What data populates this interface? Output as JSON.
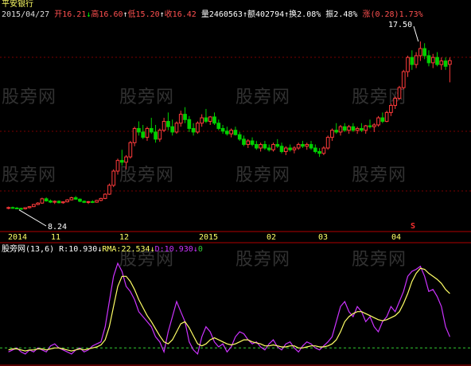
{
  "stock_name": "平安银行",
  "info_bar": {
    "date": "2015/04/27",
    "open_label": "开",
    "open": "16.21",
    "high_label": "高",
    "high": "16.60",
    "low_label": "低",
    "low": "15.20",
    "close_label": "收",
    "close": "16.42",
    "volume_label": "量",
    "volume": "2460563",
    "amount_label": "额",
    "amount": "402794",
    "turnover_label": "换",
    "turnover": "2.08%",
    "amplitude_label": "振",
    "amplitude": "2.48%",
    "change_label": "涨",
    "change": "(0.28)",
    "change_pct": "1.73%"
  },
  "price_annotations": {
    "max_label": "17.50",
    "min_label": "8.24"
  },
  "time_axis": [
    "2014",
    "11",
    "12",
    "2015",
    "02",
    "03",
    "04"
  ],
  "event_marker": "S",
  "indicator": {
    "name": "股旁网",
    "params": "(13,6)",
    "r_label": "R:10.930",
    "rma_label": "RMA:22.534",
    "d_label": "D:10.930",
    "tail_value": "0"
  },
  "watermark": "股旁网",
  "colors": {
    "background": "#000000",
    "up": "#ff3b3b",
    "down": "#00d000",
    "axis": "#b00000",
    "r_line": "#cc33ff",
    "rma_line": "#ffff66",
    "zero_line": "#33cc33"
  },
  "chart_data": {
    "type": "candlestick",
    "y_range": [
      7.2,
      18.4
    ],
    "candles": [
      [
        8.1,
        8.2,
        8.05,
        8.15
      ],
      [
        8.15,
        8.2,
        8.08,
        8.12
      ],
      [
        8.12,
        8.18,
        8.05,
        8.1
      ],
      [
        8.1,
        8.14,
        8.02,
        8.08
      ],
      [
        8.08,
        8.16,
        8.04,
        8.14
      ],
      [
        8.14,
        8.22,
        8.1,
        8.2
      ],
      [
        8.2,
        8.35,
        8.18,
        8.32
      ],
      [
        8.32,
        8.45,
        8.28,
        8.4
      ],
      [
        8.4,
        8.7,
        8.36,
        8.64
      ],
      [
        8.64,
        8.72,
        8.48,
        8.52
      ],
      [
        8.52,
        8.6,
        8.4,
        8.45
      ],
      [
        8.45,
        8.55,
        8.35,
        8.5
      ],
      [
        8.5,
        8.55,
        8.38,
        8.42
      ],
      [
        8.42,
        8.5,
        8.36,
        8.47
      ],
      [
        8.47,
        8.62,
        8.44,
        8.58
      ],
      [
        8.58,
        8.76,
        8.55,
        8.7
      ],
      [
        8.7,
        8.8,
        8.58,
        8.62
      ],
      [
        8.62,
        8.66,
        8.45,
        8.5
      ],
      [
        8.5,
        8.55,
        8.4,
        8.44
      ],
      [
        8.44,
        8.52,
        8.35,
        8.48
      ],
      [
        8.48,
        8.56,
        8.4,
        8.45
      ],
      [
        8.45,
        8.58,
        8.42,
        8.55
      ],
      [
        8.55,
        8.7,
        8.5,
        8.66
      ],
      [
        8.66,
        8.95,
        8.62,
        8.9
      ],
      [
        8.9,
        9.5,
        8.86,
        9.4
      ],
      [
        9.4,
        10.3,
        9.3,
        10.2
      ],
      [
        10.2,
        10.9,
        10.0,
        10.8
      ],
      [
        10.8,
        11.4,
        10.5,
        10.7
      ],
      [
        10.7,
        11.1,
        10.3,
        11.0
      ],
      [
        11.0,
        11.9,
        10.9,
        11.8
      ],
      [
        11.8,
        12.7,
        11.6,
        12.6
      ],
      [
        12.6,
        13.0,
        12.2,
        12.4
      ],
      [
        12.4,
        12.8,
        12.0,
        12.1
      ],
      [
        12.1,
        12.7,
        11.9,
        12.6
      ],
      [
        12.6,
        13.2,
        12.3,
        12.4
      ],
      [
        12.4,
        12.8,
        11.8,
        12.0
      ],
      [
        12.0,
        12.6,
        11.85,
        12.5
      ],
      [
        12.5,
        13.2,
        12.4,
        13.0
      ],
      [
        13.0,
        13.5,
        12.5,
        12.7
      ],
      [
        12.7,
        13.1,
        12.2,
        12.4
      ],
      [
        12.4,
        13.0,
        12.3,
        12.9
      ],
      [
        12.9,
        13.6,
        12.7,
        13.4
      ],
      [
        13.4,
        13.8,
        12.9,
        13.1
      ],
      [
        13.1,
        13.3,
        12.4,
        12.6
      ],
      [
        12.6,
        12.9,
        12.2,
        12.4
      ],
      [
        12.4,
        13.0,
        12.3,
        12.9
      ],
      [
        12.9,
        13.4,
        12.7,
        13.2
      ],
      [
        13.2,
        13.7,
        12.9,
        13.0
      ],
      [
        13.0,
        13.3,
        12.8,
        13.25
      ],
      [
        13.25,
        13.5,
        12.8,
        12.9
      ],
      [
        12.9,
        13.1,
        12.5,
        12.6
      ],
      [
        12.6,
        12.8,
        12.3,
        12.45
      ],
      [
        12.45,
        12.7,
        12.2,
        12.3
      ],
      [
        12.3,
        12.6,
        12.1,
        12.5
      ],
      [
        12.5,
        12.7,
        12.2,
        12.25
      ],
      [
        12.25,
        12.4,
        11.9,
        12.0
      ],
      [
        12.0,
        12.2,
        11.6,
        11.7
      ],
      [
        11.7,
        12.0,
        11.5,
        11.9
      ],
      [
        11.9,
        12.1,
        11.6,
        11.7
      ],
      [
        11.7,
        11.9,
        11.4,
        11.5
      ],
      [
        11.5,
        11.8,
        11.3,
        11.7
      ],
      [
        11.7,
        11.9,
        11.4,
        11.5
      ],
      [
        11.5,
        11.7,
        11.3,
        11.4
      ],
      [
        11.4,
        11.8,
        11.3,
        11.7
      ],
      [
        11.7,
        12.0,
        11.5,
        11.6
      ],
      [
        11.6,
        11.8,
        11.2,
        11.3
      ],
      [
        11.3,
        11.6,
        11.1,
        11.5
      ],
      [
        11.5,
        11.7,
        11.3,
        11.4
      ],
      [
        11.4,
        11.6,
        11.2,
        11.5
      ],
      [
        11.5,
        11.8,
        11.4,
        11.7
      ],
      [
        11.7,
        11.9,
        11.5,
        11.6
      ],
      [
        11.6,
        11.8,
        11.4,
        11.7
      ],
      [
        11.7,
        11.9,
        11.4,
        11.5
      ],
      [
        11.5,
        11.7,
        11.2,
        11.3
      ],
      [
        11.3,
        11.5,
        11.0,
        11.2
      ],
      [
        11.2,
        11.6,
        11.1,
        11.5
      ],
      [
        11.5,
        12.2,
        11.4,
        12.1
      ],
      [
        12.1,
        12.6,
        11.9,
        12.5
      ],
      [
        12.5,
        12.9,
        12.3,
        12.4
      ],
      [
        12.4,
        12.8,
        12.2,
        12.7
      ],
      [
        12.7,
        12.9,
        12.4,
        12.5
      ],
      [
        12.5,
        12.8,
        12.3,
        12.7
      ],
      [
        12.7,
        12.9,
        12.4,
        12.5
      ],
      [
        12.5,
        12.7,
        12.3,
        12.6
      ],
      [
        12.6,
        12.9,
        12.4,
        12.5
      ],
      [
        12.5,
        12.8,
        12.3,
        12.75
      ],
      [
        12.75,
        13.1,
        12.6,
        12.7
      ],
      [
        12.7,
        12.9,
        12.4,
        12.8
      ],
      [
        12.8,
        13.3,
        12.7,
        13.2
      ],
      [
        13.2,
        13.5,
        12.9,
        13.0
      ],
      [
        13.0,
        13.6,
        12.95,
        13.5
      ],
      [
        13.5,
        14.0,
        13.3,
        13.9
      ],
      [
        13.9,
        14.4,
        13.7,
        14.3
      ],
      [
        14.3,
        15.0,
        14.2,
        14.9
      ],
      [
        14.9,
        15.9,
        14.8,
        15.8
      ],
      [
        15.8,
        16.7,
        15.5,
        16.6
      ],
      [
        16.6,
        17.0,
        15.9,
        16.2
      ],
      [
        16.2,
        16.9,
        16.0,
        16.7
      ],
      [
        16.7,
        17.5,
        16.4,
        17.1
      ],
      [
        17.1,
        17.4,
        16.5,
        16.7
      ],
      [
        16.7,
        17.0,
        16.1,
        16.3
      ],
      [
        16.3,
        16.8,
        16.0,
        16.6
      ],
      [
        16.6,
        16.9,
        16.1,
        16.2
      ],
      [
        16.2,
        16.6,
        15.9,
        16.4
      ],
      [
        16.4,
        16.6,
        15.9,
        16.1
      ],
      [
        16.21,
        16.6,
        15.2,
        16.42
      ]
    ],
    "indicator_series": [
      {
        "name": "R",
        "values": [
          10,
          12,
          14,
          10,
          8,
          12,
          10,
          14,
          12,
          10,
          16,
          18,
          14,
          12,
          10,
          8,
          12,
          14,
          10,
          12,
          16,
          18,
          20,
          35,
          60,
          85,
          98,
          90,
          75,
          70,
          62,
          50,
          45,
          40,
          35,
          25,
          20,
          10,
          30,
          45,
          60,
          50,
          40,
          20,
          12,
          8,
          25,
          35,
          30,
          20,
          15,
          18,
          10,
          15,
          25,
          30,
          28,
          22,
          18,
          20,
          15,
          12,
          18,
          22,
          15,
          12,
          18,
          20,
          14,
          10,
          16,
          20,
          18,
          14,
          12,
          16,
          20,
          25,
          40,
          55,
          60,
          50,
          45,
          55,
          50,
          40,
          45,
          35,
          30,
          40,
          45,
          55,
          50,
          60,
          70,
          85,
          90,
          92,
          95,
          85,
          70,
          72,
          65,
          55,
          35,
          25
        ]
      },
      {
        "name": "RMA",
        "values": [
          12,
          13,
          13,
          12,
          11,
          12,
          12,
          13,
          13,
          12,
          13,
          14,
          14,
          13,
          12,
          11,
          12,
          13,
          12,
          13,
          14,
          15,
          17,
          22,
          35,
          55,
          75,
          85,
          85,
          80,
          72,
          62,
          54,
          46,
          40,
          33,
          26,
          20,
          18,
          22,
          30,
          38,
          40,
          34,
          26,
          18,
          16,
          18,
          22,
          24,
          22,
          20,
          18,
          17,
          18,
          20,
          22,
          22,
          20,
          19,
          18,
          16,
          16,
          17,
          16,
          15,
          15,
          16,
          16,
          14,
          14,
          15,
          16,
          16,
          15,
          15,
          16,
          18,
          22,
          30,
          40,
          45,
          48,
          50,
          50,
          48,
          46,
          44,
          42,
          41,
          42,
          44,
          46,
          50,
          58,
          68,
          80,
          88,
          93,
          92,
          88,
          85,
          82,
          78,
          72,
          68
        ]
      }
    ],
    "indicator_range": [
      0,
      105
    ],
    "zero_value": 14
  }
}
